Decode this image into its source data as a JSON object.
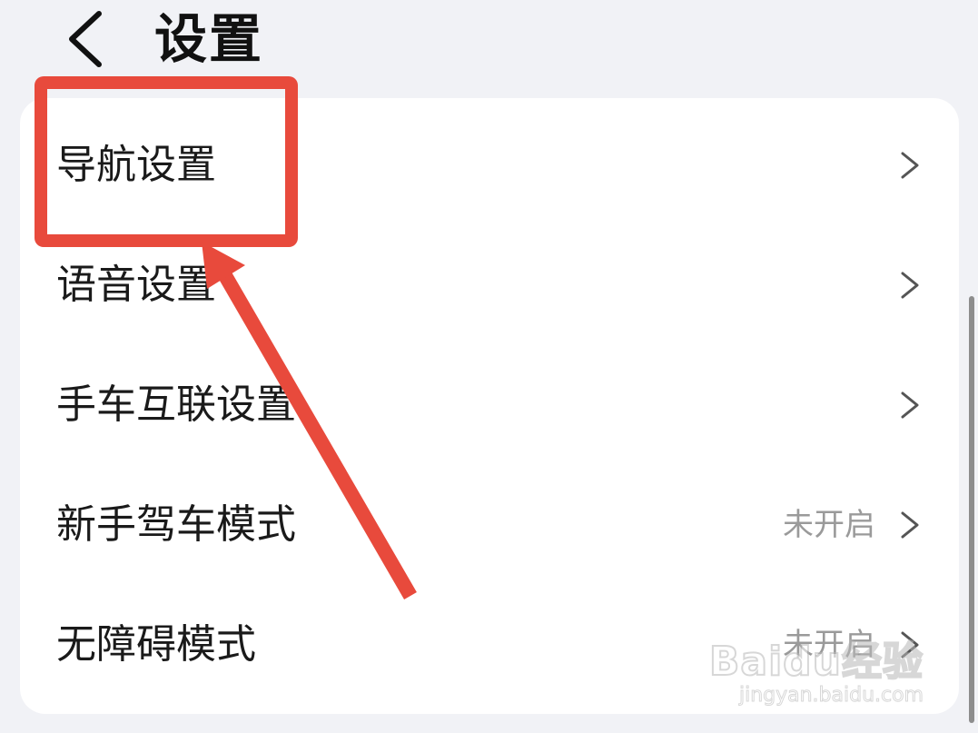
{
  "header": {
    "back_icon": "chevron-left-icon",
    "title": "设置"
  },
  "settings": {
    "items": [
      {
        "label": "导航设置",
        "status": "",
        "icon": "chevron-right-icon"
      },
      {
        "label": "语音设置",
        "status": "",
        "icon": "chevron-right-icon"
      },
      {
        "label": "手车互联设置",
        "status": "",
        "icon": "chevron-right-icon"
      },
      {
        "label": "新手驾车模式",
        "status": "未开启",
        "icon": "chevron-right-icon"
      },
      {
        "label": "无障碍模式",
        "status": "未开启",
        "icon": "chevron-right-icon"
      }
    ]
  },
  "annotation": {
    "highlight_color": "#e84a3c",
    "highlighted_item": "导航设置"
  },
  "watermark": {
    "logo": "Baidu经验",
    "url": "jingyan.baidu.com"
  },
  "colors": {
    "background": "#f1f2f6",
    "card": "#ffffff",
    "text": "#1a1a1a",
    "status_text": "#9a9a9a",
    "annotation_red": "#e84a3c"
  }
}
